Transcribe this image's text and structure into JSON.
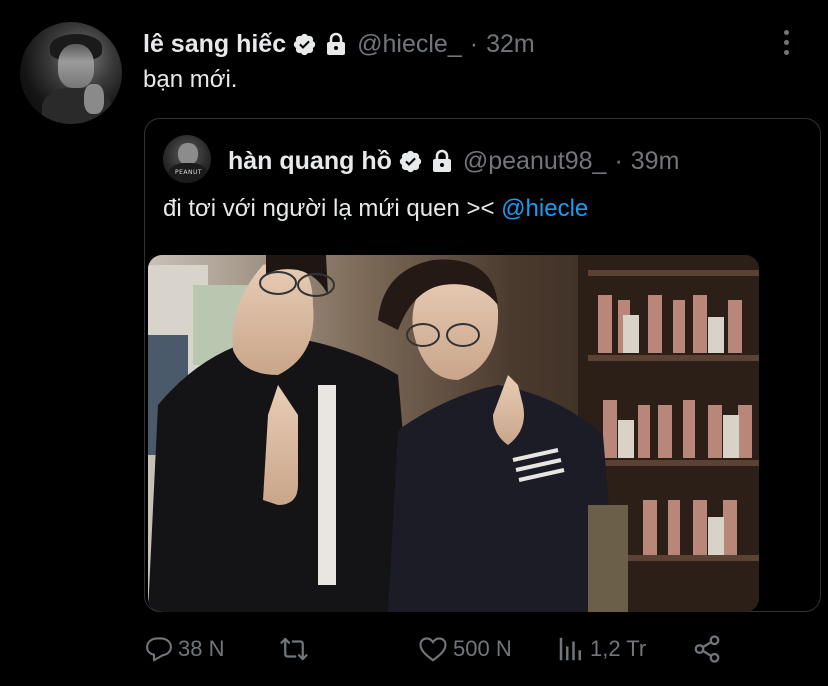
{
  "tweet": {
    "display_name": "lê sang hiếc",
    "handle": "@hiecle_",
    "separator": "·",
    "time": "32m",
    "text": "bạn mới.",
    "verified": true,
    "protected": true
  },
  "quoted_tweet": {
    "display_name": "hàn quang hồ",
    "handle": "@peanut98_",
    "separator": "·",
    "time": "39m",
    "text_before_mention": "đi tơi với người lạ mứi quen ><",
    "mention": "@hiecle",
    "verified": true,
    "protected": true,
    "avatar_shirt_text": "PEANUT",
    "media": "photo of two young men posing in front of a store shelf"
  },
  "actions": {
    "reply_count": "38 N",
    "retweet_count": "",
    "like_count": "500 N",
    "views_count": "1,2 Tr"
  },
  "colors": {
    "background": "#000000",
    "text_primary": "#e7e9ea",
    "text_secondary": "#71767b",
    "accent": "#1d9bf0",
    "border": "#2f3336"
  },
  "icons": [
    "verified-badge-icon",
    "lock-icon",
    "more-icon",
    "reply-icon",
    "retweet-icon",
    "like-icon",
    "views-icon",
    "share-icon"
  ]
}
